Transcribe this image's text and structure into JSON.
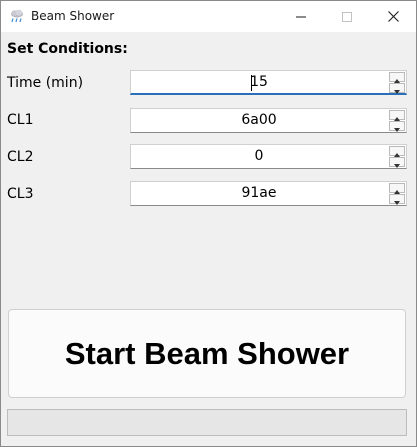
{
  "window": {
    "title": "Beam Shower",
    "icon": "rain-cloud-icon"
  },
  "section": {
    "label": "Set Conditions:"
  },
  "fields": [
    {
      "label": "Time (min)",
      "value": "15",
      "focused": true
    },
    {
      "label": "CL1",
      "value": "6a00"
    },
    {
      "label": "CL2",
      "value": "0"
    },
    {
      "label": "CL3",
      "value": "91ae"
    }
  ],
  "start_button": {
    "label": "Start Beam Shower"
  },
  "progress": {
    "value": 0
  },
  "colors": {
    "focus_accent": "#2a6fb8",
    "window_bg": "#f0f0f0"
  }
}
